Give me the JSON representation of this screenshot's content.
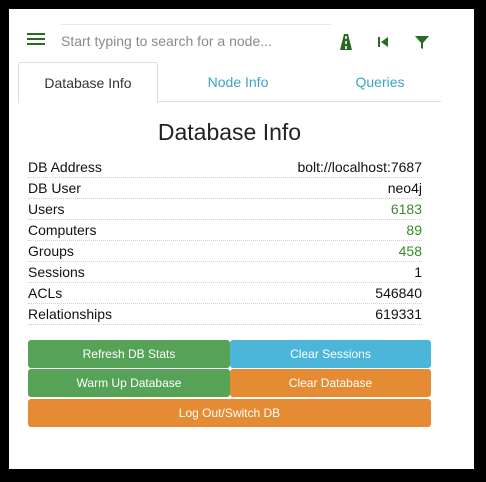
{
  "search": {
    "placeholder": "Start typing to search for a node..."
  },
  "toolbar": {
    "icons": [
      "menu-icon",
      "path-finding-icon",
      "back-icon",
      "filter-icon"
    ]
  },
  "tabs": [
    {
      "label": "Database Info",
      "active": true
    },
    {
      "label": "Node Info",
      "active": false
    },
    {
      "label": "Queries",
      "active": false
    }
  ],
  "db_info": {
    "title": "Database Info",
    "rows": [
      {
        "label": "DB Address",
        "value": "bolt://localhost:7687"
      },
      {
        "label": "DB User",
        "value": "neo4j"
      },
      {
        "label": "Users",
        "value": "6183"
      },
      {
        "label": "Computers",
        "value": "89"
      },
      {
        "label": "Groups",
        "value": "458"
      },
      {
        "label": "Sessions",
        "value": "1"
      },
      {
        "label": "ACLs",
        "value": "546840"
      },
      {
        "label": "Relationships",
        "value": "619331"
      }
    ]
  },
  "buttons": {
    "refresh": "Refresh DB Stats",
    "clear_sessions": "Clear Sessions",
    "warm_up": "Warm Up Database",
    "clear_database": "Clear Database",
    "logout": "Log Out/Switch DB"
  },
  "colors": {
    "accent_green": "#56a357",
    "accent_blue": "#4bb6da",
    "accent_orange": "#e48b34",
    "link_blue": "#3aa3c4"
  }
}
